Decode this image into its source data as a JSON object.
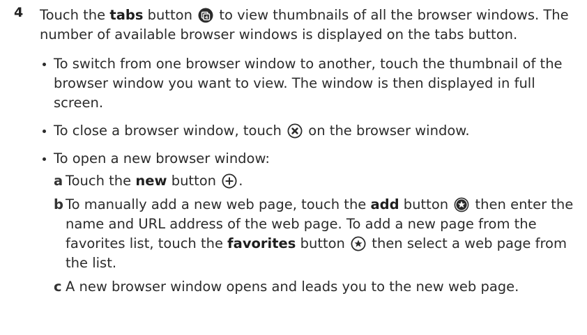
{
  "step": {
    "number": "4",
    "p1": "Touch the ",
    "bold1": "tabs",
    "p2": " button ",
    "p3": " to view thumbnails of all the browser windows. The number of available browser windows is displayed on the tabs button."
  },
  "bullets": {
    "switch": "To switch from one browser window to another, touch the thumbnail of the browser window you want to view. The window is then displayed in full screen.",
    "close_pre": "To close a browser window, touch ",
    "close_post": " on the browser window.",
    "open": "To open a new browser window:"
  },
  "substeps": {
    "a": {
      "letter": "a",
      "p1": "Touch the ",
      "bold": "new",
      "p2": " button ",
      "p3": "."
    },
    "b": {
      "letter": "b",
      "p1": "To manually add a new web page, touch the ",
      "bold1": "add",
      "p2": " button ",
      "p3": " then enter the name and URL address of the web page. To add a new page from the favorites list, touch the ",
      "bold2": "favorites",
      "p4": " button ",
      "p5": " then select a web page from the list."
    },
    "c": {
      "letter": "c",
      "text": "A new browser window opens and leads you to the new web page."
    }
  },
  "icons": {
    "tabs": "tabs-icon",
    "close": "close-circle-icon",
    "new": "plus-circle-icon",
    "add": "star-filled-circle-icon",
    "favorites": "star-circle-icon",
    "tabs_count": "4",
    "ink_color": "#2b2b2b"
  }
}
